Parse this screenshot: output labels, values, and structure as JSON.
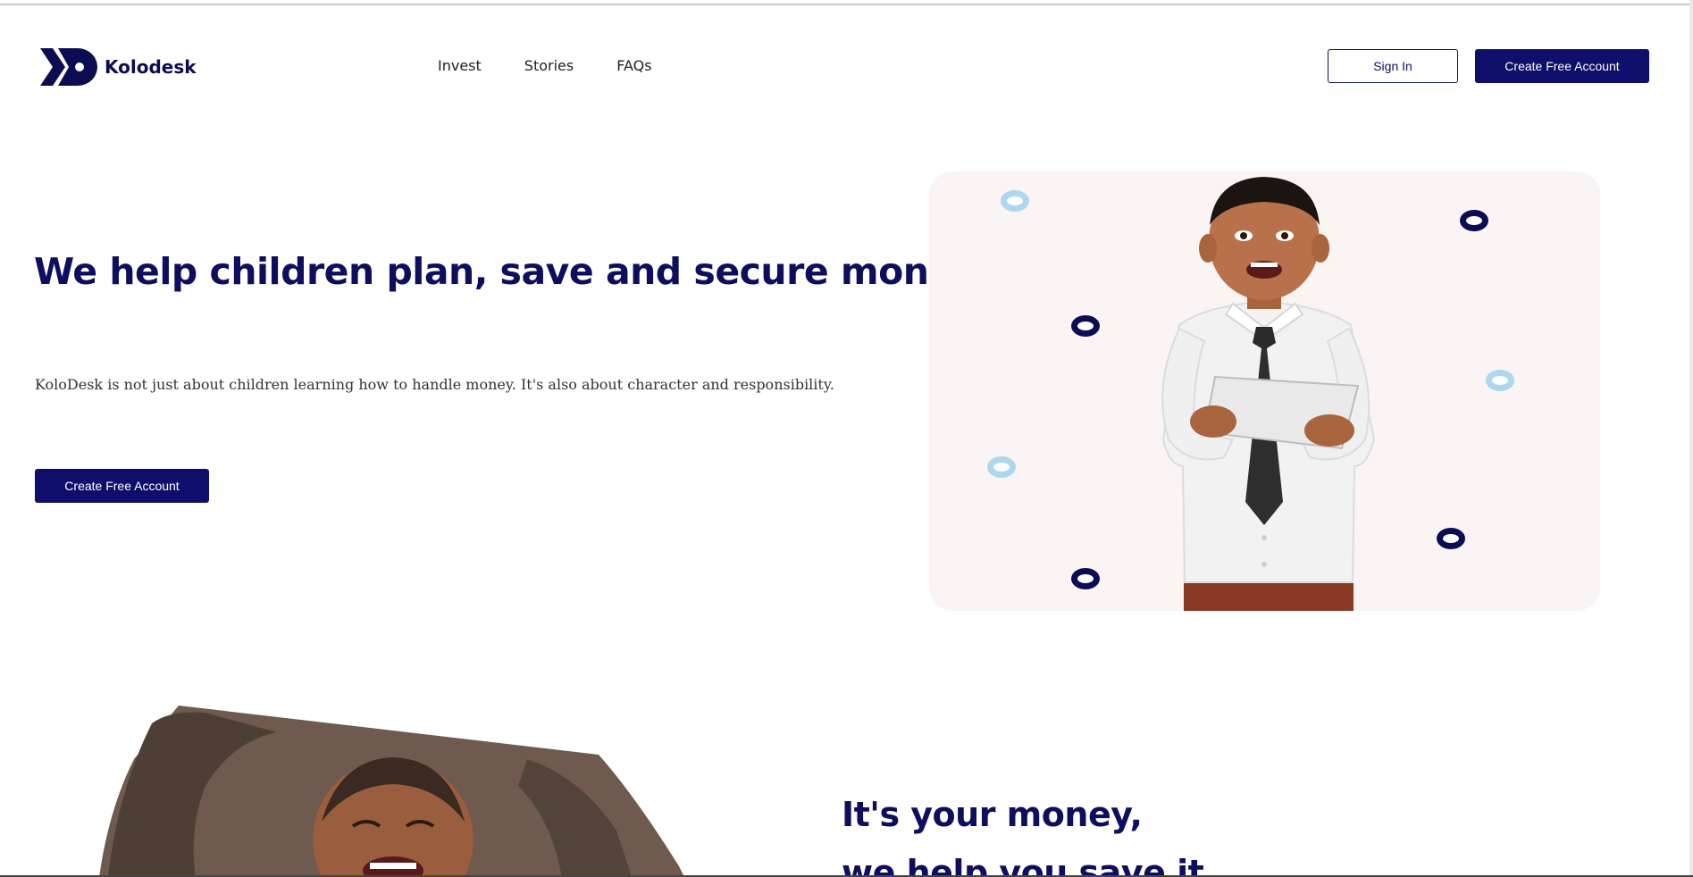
{
  "header": {
    "logo_text": "Kolodesk",
    "nav": [
      "Invest",
      "Stories",
      "FAQs"
    ],
    "sign_in_label": "Sign In",
    "create_account_label": "Create Free Account"
  },
  "hero": {
    "title": "We help children plan, save and secure money",
    "description": "KoloDesk is not just about children learning how to handle money. It's also about character and responsibility.",
    "cta_label": "Create Free Account"
  },
  "section2": {
    "title": "It's your money,",
    "subtitle": "we help you save it"
  },
  "colors": {
    "brand_navy": "#0f0f6b",
    "heading_navy": "#0e0e5e",
    "card_bg": "#faf4f4",
    "dot_light": "#add7ec"
  },
  "icons": {
    "logo": "kolodesk-logo-icon"
  }
}
